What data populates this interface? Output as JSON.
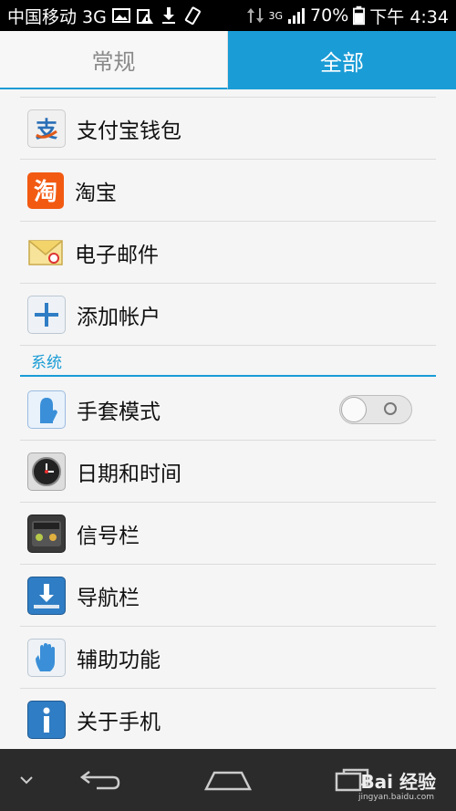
{
  "status_bar": {
    "carrier": "中国移动 3G",
    "network_small": "3G",
    "battery": "70%",
    "time": "下午 4:34"
  },
  "tabs": [
    {
      "label": "常规",
      "active": false
    },
    {
      "label": "全部",
      "active": true
    }
  ],
  "accounts": [
    {
      "label": "支付宝钱包",
      "icon": "alipay-icon"
    },
    {
      "label": "淘宝",
      "icon": "taobao-icon"
    },
    {
      "label": "电子邮件",
      "icon": "email-icon"
    },
    {
      "label": "添加帐户",
      "icon": "plus-icon"
    }
  ],
  "system_section": {
    "title": "系统",
    "items": [
      {
        "label": "手套模式",
        "icon": "glove-icon",
        "toggle": "off"
      },
      {
        "label": "日期和时间",
        "icon": "clock-icon"
      },
      {
        "label": "信号栏",
        "icon": "statusbar-icon"
      },
      {
        "label": "导航栏",
        "icon": "navbar-icon"
      },
      {
        "label": "辅助功能",
        "icon": "hand-icon"
      },
      {
        "label": "关于手机",
        "icon": "info-icon"
      }
    ]
  },
  "watermark": {
    "main": "Bai 经验",
    "sub": "jingyan.baidu.com"
  },
  "colors": {
    "accent": "#1a9cd6",
    "statusbar": "#000000",
    "navbar": "#2b2b2b"
  }
}
